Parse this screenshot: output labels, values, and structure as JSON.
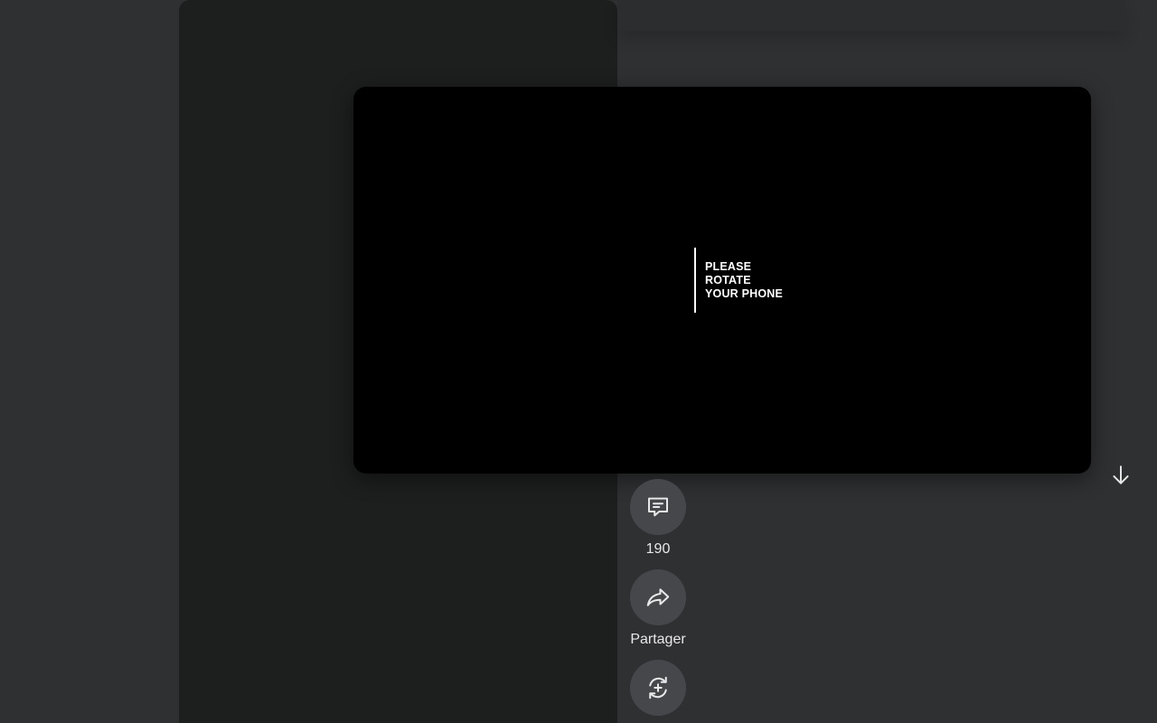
{
  "overlay": {
    "message_lines": [
      "PLEASE",
      "ROTATE",
      "YOUR PHONE"
    ]
  },
  "actions": {
    "comments": {
      "icon": "comment-icon",
      "count": "190"
    },
    "share": {
      "icon": "share-icon",
      "label": "Partager"
    },
    "remix": {
      "icon": "remix-icon"
    }
  },
  "navigation": {
    "scroll_down_icon": "arrow-down-icon"
  },
  "colors": {
    "page_background": "#2f3032",
    "short_column_background": "#1d1e1e",
    "overlay_background": "#000000",
    "action_button_background": "#45474a",
    "text_light": "#e8e8e8"
  }
}
